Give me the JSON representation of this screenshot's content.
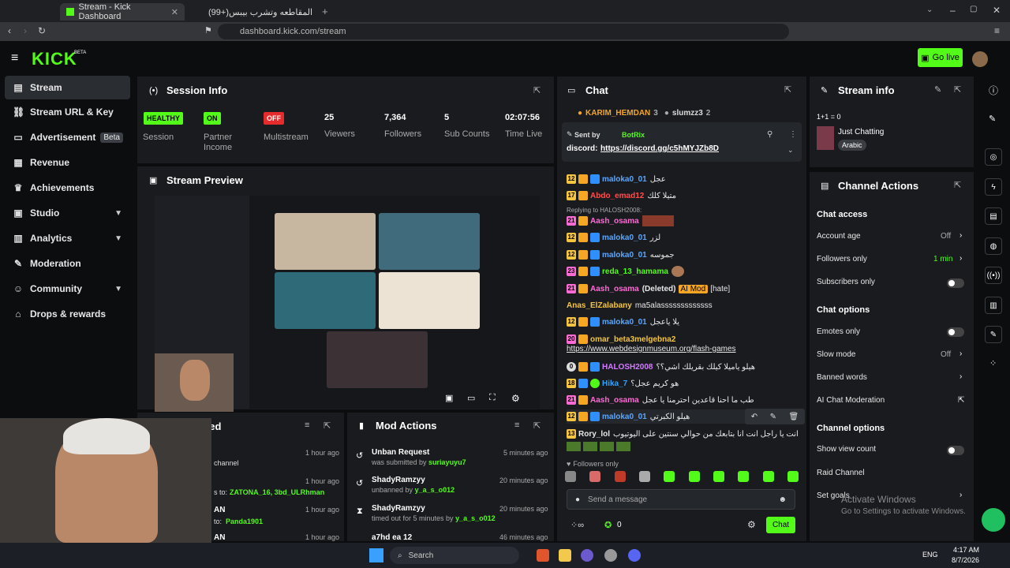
{
  "browser": {
    "tabs": [
      {
        "title": "Stream - Kick Dashboard"
      },
      {
        "title": "(99+)متنساش المقاطعه وتشرب بيبس"
      }
    ],
    "url": "dashboard.kick.com/stream"
  },
  "header": {
    "logo": "KICK",
    "logo_sup": "BETA",
    "go_live": "Go live"
  },
  "sidebar": {
    "items": [
      {
        "label": "Stream",
        "icon": "stream-icon"
      },
      {
        "label": "Stream URL & Key",
        "icon": "link-icon"
      },
      {
        "label": "Advertisement",
        "icon": "ad-icon",
        "badge": "Beta"
      },
      {
        "label": "Revenue",
        "icon": "revenue-icon"
      },
      {
        "label": "Achievements",
        "icon": "trophy-icon"
      },
      {
        "label": "Studio",
        "icon": "studio-icon"
      },
      {
        "label": "Analytics",
        "icon": "analytics-icon"
      },
      {
        "label": "Moderation",
        "icon": "wrench-icon"
      },
      {
        "label": "Community",
        "icon": "community-icon"
      },
      {
        "label": "Drops & rewards",
        "icon": "gift-icon"
      }
    ]
  },
  "session": {
    "title": "Session Info",
    "stats": [
      {
        "value": "HEALTHY",
        "label": "Session"
      },
      {
        "value": "ON",
        "label": "Partner Income"
      },
      {
        "value": "OFF",
        "label": "Multistream"
      },
      {
        "value": "25",
        "label": "Viewers"
      },
      {
        "value": "7,364",
        "label": "Followers"
      },
      {
        "value": "5",
        "label": "Sub Counts"
      },
      {
        "value": "02:07:56",
        "label": "Time Live"
      }
    ]
  },
  "preview": {
    "title": "Stream Preview"
  },
  "activity": {
    "title_partial": "eed",
    "items": [
      {
        "text": "channel",
        "time": "1 hour ago"
      },
      {
        "text_pre": "s to:",
        "names": "ZATONA_16, 3bd_ULRhman",
        "time": "1 hour ago"
      },
      {
        "text": "AN",
        "sub_pre": "to:",
        "sub_name": "Panda1901",
        "time": "1 hour ago"
      },
      {
        "text": "AN",
        "time": "1 hour ago"
      }
    ]
  },
  "mod_actions": {
    "title": "Mod Actions",
    "items": [
      {
        "title": "Unban Request",
        "sub_pre": "was submitted by",
        "sub_name": "suriayuyu7",
        "time": "5 minutes ago"
      },
      {
        "title": "ShadyRamzyy",
        "sub_pre": "unbanned by",
        "sub_name": "y_a_s_o012",
        "time": "20 minutes ago"
      },
      {
        "title": "ShadyRamzyy",
        "sub_pre": "timed out for 5 minutes by",
        "sub_name": "y_a_s_o012",
        "time": "20 minutes ago"
      },
      {
        "title": "a7hd ea 12",
        "time": "46 minutes ago"
      }
    ]
  },
  "chat": {
    "title": "Chat",
    "top_users": [
      {
        "name": "KARIM_HEMDAN",
        "count": "3"
      },
      {
        "name": "slumzz3",
        "count": "2"
      }
    ],
    "pinned": {
      "sent_by": "Sent by",
      "bot": "BotRix",
      "text_pre": "discord:",
      "link": "https://discord.gg/c5hMYJZb8D"
    },
    "messages": [
      {
        "badge": "12",
        "name": "maloka0_01",
        "color": "#5aa6ff",
        "text": "عجل"
      },
      {
        "badge": "17",
        "name": "Abdo_emad12",
        "color": "#ff4d4d",
        "text": "متيلا كلك"
      },
      {
        "reply": "Replying to HALOSH2008:",
        "badge": "21",
        "name": "Aash_osama",
        "color": "#ff6ad5",
        "text": ""
      },
      {
        "badge": "12",
        "name": "maloka0_01",
        "color": "#5aa6ff",
        "text": "لزر"
      },
      {
        "badge": "12",
        "name": "maloka0_01",
        "color": "#5aa6ff",
        "text": "جموسه"
      },
      {
        "badge": "23",
        "name": "reda_13_hamama",
        "color": "#53fc18",
        "text": ""
      },
      {
        "badge": "21",
        "name": "Aash_osama",
        "color": "#ff6ad5",
        "text": "",
        "deleted": "(Deleted)",
        "tag": "AI Mod",
        "tag2": "[hate]"
      },
      {
        "badge": "",
        "name": "Anas_ElZalabany",
        "color": "#f5c542",
        "text": "ma5alasssssssssssss"
      },
      {
        "badge": "12",
        "name": "maloka0_01",
        "color": "#5aa6ff",
        "text": "يلا ياعجل"
      },
      {
        "badge": "20",
        "name": "omar_beta3melgebna2",
        "color": "#f5c542",
        "text": "https://www.webdesignmuseum.org/flash-games"
      },
      {
        "badge": "0",
        "name": "HALOSH2008",
        "color": "#d37bff",
        "text": "هيلو ياميلا كيلك بقريلك اشي؟؟"
      },
      {
        "badge": "18",
        "name": "Hika_7",
        "color": "#2fa4ff",
        "text": "هو كريم عجل؟"
      },
      {
        "badge": "21",
        "name": "Aash_osama",
        "color": "#ff6ad5",
        "text": "طب ما احنا قاعدين احترمنا يا عجل"
      },
      {
        "badge": "12",
        "name": "maloka0_01",
        "color": "#5aa6ff",
        "text": "هيلو الكبرتي"
      },
      {
        "badge": "13",
        "name": "Rory_lol",
        "color": "#e8e8e8",
        "text": "انت يا راجل انت انا بتابعك من حوالي سنتين على اليوتيوب"
      }
    ],
    "followers_only": "Followers only",
    "input_placeholder": "Send a message",
    "points": "0",
    "send_label": "Chat"
  },
  "stream_info": {
    "title": "Stream info",
    "stream_title": "1+1 = 0",
    "category": "Just Chatting",
    "language": "Arabic"
  },
  "channel_actions": {
    "title": "Channel Actions",
    "chat_access": "Chat access",
    "rows": [
      {
        "label": "Account age",
        "value": "Off"
      },
      {
        "label": "Followers only",
        "value": "1 min"
      },
      {
        "label": "Subscribers only",
        "value": ""
      }
    ],
    "chat_options": "Chat options",
    "rows2": [
      {
        "label": "Emotes only",
        "value": ""
      },
      {
        "label": "Slow mode",
        "value": "Off"
      },
      {
        "label": "Banned words",
        "value": ""
      },
      {
        "label": "AI Chat Moderation",
        "value": ""
      }
    ],
    "channel_options": "Channel options",
    "rows3": [
      {
        "label": "Show view count",
        "value": ""
      },
      {
        "label": "Raid Channel",
        "value": ""
      },
      {
        "label": "Set goals",
        "value": ""
      }
    ]
  },
  "windows": {
    "watermark1": "Activate Windows",
    "watermark2": "Go to Settings to activate Windows.",
    "search": "Search",
    "lang": "ENG",
    "time": "4:17 AM",
    "date": "8/7/2026"
  },
  "colors": {
    "kick_green": "#53fc18",
    "panel": "#191b1f",
    "bg": "#0b0d0f"
  }
}
